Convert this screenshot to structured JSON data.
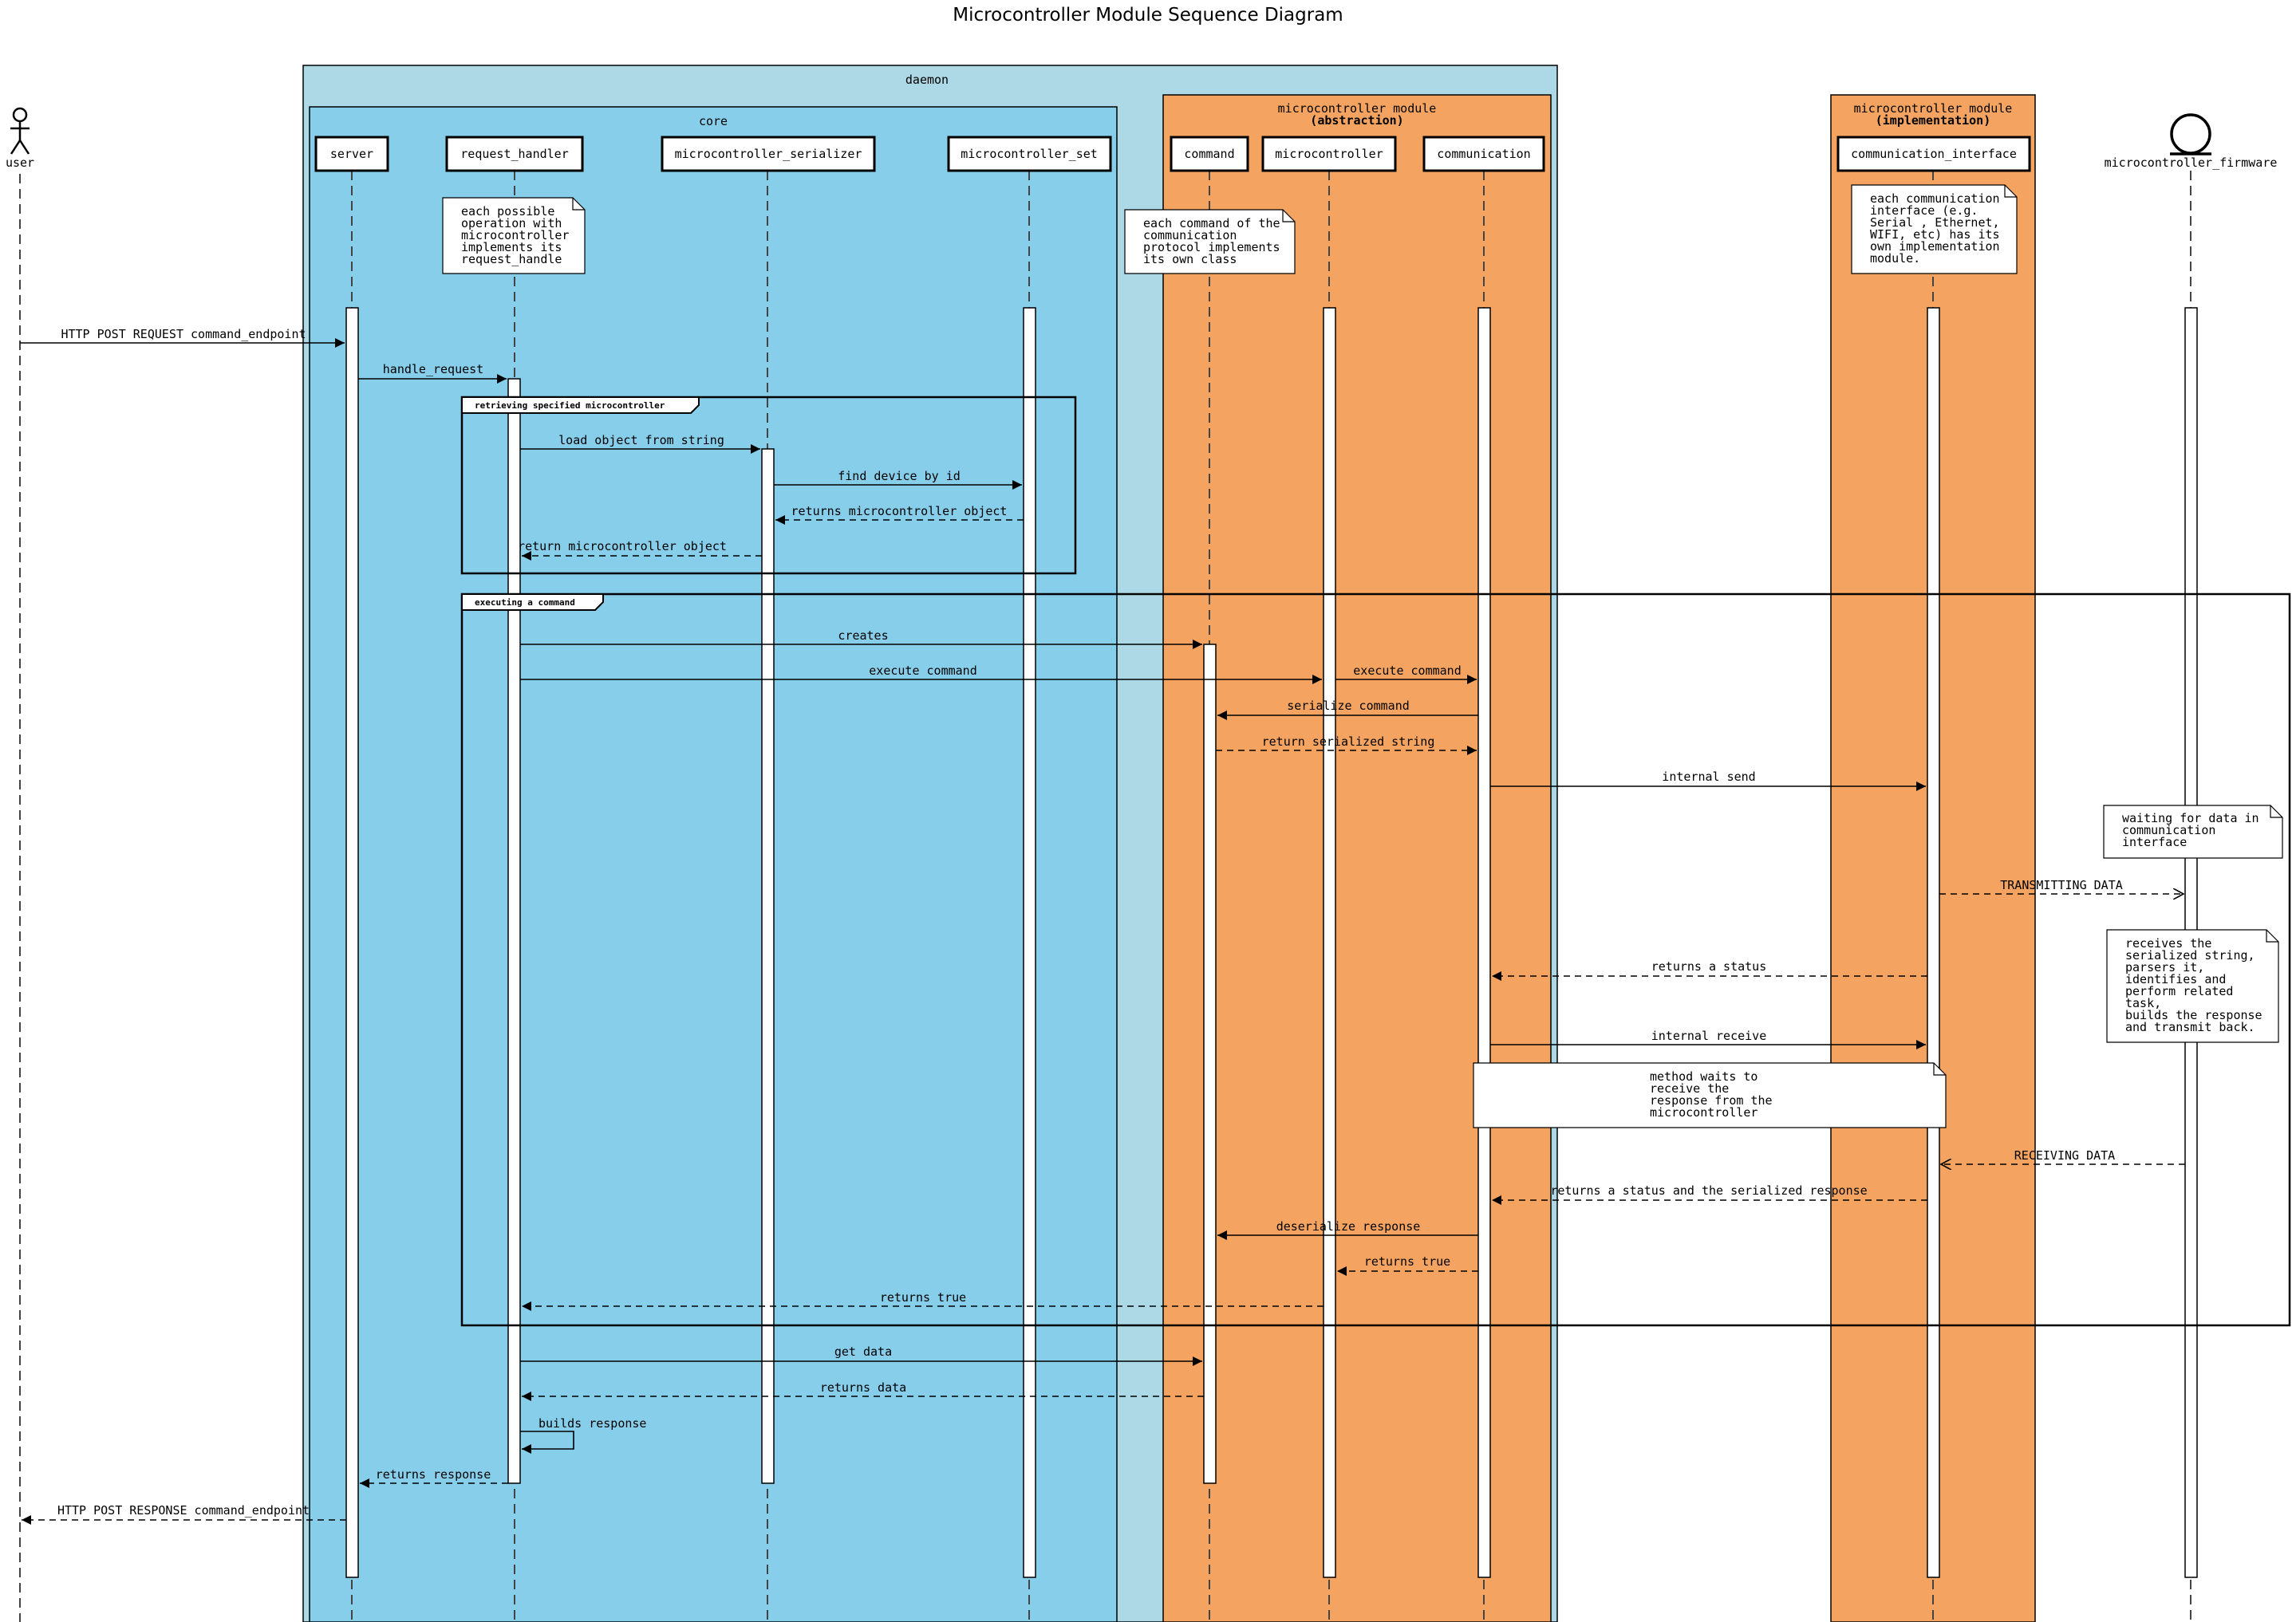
{
  "title": "Microcontroller Module Sequence Diagram",
  "colors": {
    "daemon": "#add8e6",
    "core": "#87ceeb",
    "module": "#f4a460"
  },
  "packages": {
    "daemon": "daemon",
    "core": "core",
    "module_abstraction": {
      "line1": "microcontroller module",
      "line2": "(abstraction)"
    },
    "module_implementation": {
      "line1": "microcontroller module",
      "line2": "(implementation)"
    }
  },
  "participants": {
    "user": "user",
    "server": "server",
    "request_handler": "request_handler",
    "microcontroller_serializer": "microcontroller_serializer",
    "microcontroller_set": "microcontroller_set",
    "command": "command",
    "microcontroller": "microcontroller",
    "communication": "communication",
    "communication_interface": "communication_interface",
    "microcontroller_firmware": "microcontroller_firmware"
  },
  "frames": {
    "retrieve": "retrieving specified microcontroller",
    "execute": "executing a command"
  },
  "notes": {
    "request_handle": [
      "each possible",
      "operation with",
      "microcontroller",
      "implements its",
      "request_handle"
    ],
    "command_class": [
      "each command of the",
      "communication",
      "protocol implements",
      "its own class"
    ],
    "interface_impl": [
      "each communication",
      "interface (e.g.",
      "Serial , Ethernet,",
      "WIFI, etc) has its",
      "own implementation",
      "module."
    ],
    "waiting": [
      "waiting for data in",
      "communication",
      "interface"
    ],
    "receives": [
      "receives the",
      "serialized string,",
      "parsers it,",
      "identifies and",
      "perform related",
      "task,",
      "builds the response",
      "and transmit back."
    ],
    "method_waits": [
      "method waits to",
      "receive the",
      "response from the",
      "microcontroller"
    ]
  },
  "messages": {
    "http_post_request": "HTTP POST REQUEST command_endpoint",
    "handle_request": "handle_request",
    "load_object": "load object from string",
    "find_device": "find device by id",
    "returns_microcontroller_object": "returns microcontroller object",
    "return_microcontroller_object": "return microcontroller object",
    "creates": "creates",
    "execute_command_1": "execute command",
    "execute_command_2": "execute command",
    "serialize_command": "serialize command",
    "return_serialized": "return serialized string",
    "internal_send": "internal send",
    "transmitting": "TRANSMITTING DATA",
    "returns_status": "returns a status",
    "internal_receive": "internal receive",
    "receiving": "RECEIVING DATA",
    "returns_status_serialized": "returns a status and the serialized response",
    "deserialize": "deserialize response",
    "returns_true_1": "returns true",
    "returns_true_2": "returns true",
    "get_data": "get data",
    "returns_data": "returns data",
    "builds_response": "builds response",
    "returns_response": "returns response",
    "http_post_response": "HTTP POST RESPONSE command_endpoint"
  }
}
